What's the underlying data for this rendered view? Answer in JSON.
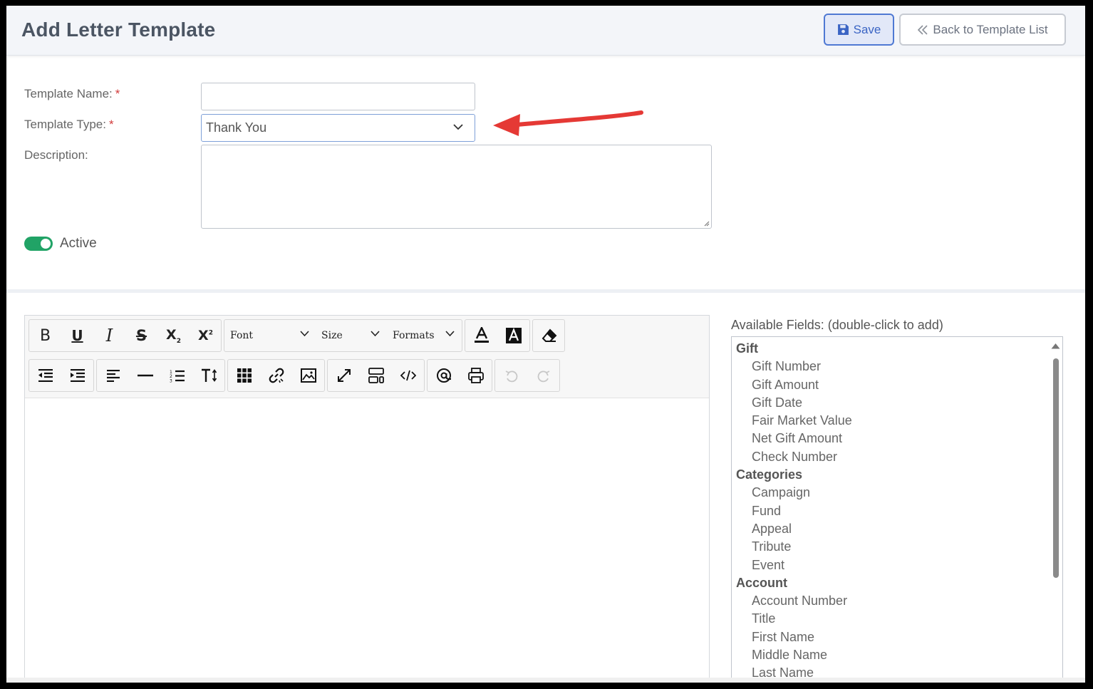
{
  "header": {
    "title": "Add Letter Template",
    "save_label": "Save",
    "back_label": "Back to Template List"
  },
  "form": {
    "template_name_label": "Template Name:",
    "template_name_value": "",
    "template_type_label": "Template Type:",
    "template_type_value": "Thank You",
    "description_label": "Description:",
    "required_mark": "*",
    "active_label": "Active",
    "active_on": true
  },
  "editor": {
    "font_label": "Font",
    "size_label": "Size",
    "formats_label": "Formats"
  },
  "fields": {
    "title": "Available Fields: (double-click to add)",
    "groups": [
      {
        "name": "Gift",
        "items": [
          "Gift Number",
          "Gift Amount",
          "Gift Date",
          "Fair Market Value",
          "Net Gift Amount",
          "Check Number"
        ]
      },
      {
        "name": "Categories",
        "items": [
          "Campaign",
          "Fund",
          "Appeal",
          "Tribute",
          "Event"
        ]
      },
      {
        "name": "Account",
        "items": [
          "Account Number",
          "Title",
          "First Name",
          "Middle Name",
          "Last Name"
        ]
      }
    ]
  },
  "colors": {
    "accent_blue": "#3a64c4",
    "toggle_green": "#21a366",
    "annotation_arrow": "#e53935",
    "required_red": "#d23b3b"
  }
}
